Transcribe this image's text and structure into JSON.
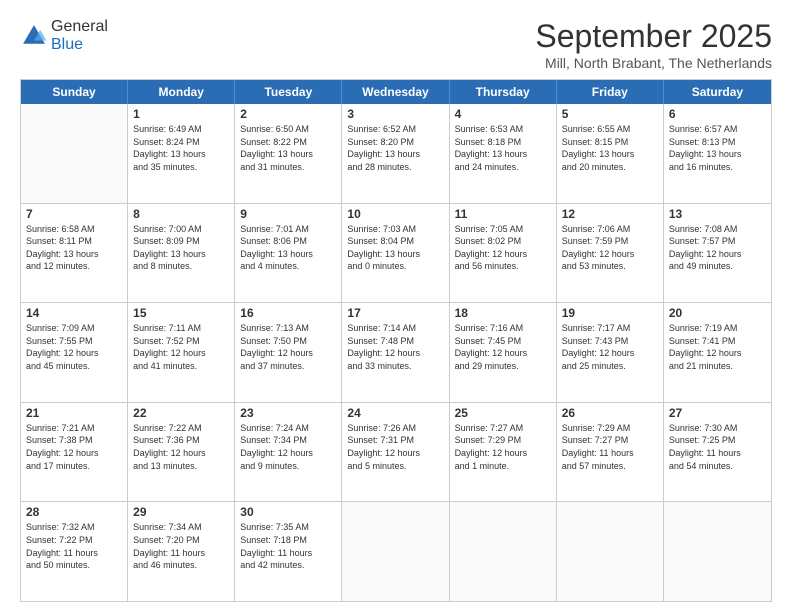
{
  "header": {
    "logo_line1": "General",
    "logo_line2": "Blue",
    "title": "September 2025",
    "subtitle": "Mill, North Brabant, The Netherlands"
  },
  "days_of_week": [
    "Sunday",
    "Monday",
    "Tuesday",
    "Wednesday",
    "Thursday",
    "Friday",
    "Saturday"
  ],
  "weeks": [
    [
      {
        "day": "",
        "empty": true,
        "lines": []
      },
      {
        "day": "1",
        "empty": false,
        "lines": [
          "Sunrise: 6:49 AM",
          "Sunset: 8:24 PM",
          "Daylight: 13 hours",
          "and 35 minutes."
        ]
      },
      {
        "day": "2",
        "empty": false,
        "lines": [
          "Sunrise: 6:50 AM",
          "Sunset: 8:22 PM",
          "Daylight: 13 hours",
          "and 31 minutes."
        ]
      },
      {
        "day": "3",
        "empty": false,
        "lines": [
          "Sunrise: 6:52 AM",
          "Sunset: 8:20 PM",
          "Daylight: 13 hours",
          "and 28 minutes."
        ]
      },
      {
        "day": "4",
        "empty": false,
        "lines": [
          "Sunrise: 6:53 AM",
          "Sunset: 8:18 PM",
          "Daylight: 13 hours",
          "and 24 minutes."
        ]
      },
      {
        "day": "5",
        "empty": false,
        "lines": [
          "Sunrise: 6:55 AM",
          "Sunset: 8:15 PM",
          "Daylight: 13 hours",
          "and 20 minutes."
        ]
      },
      {
        "day": "6",
        "empty": false,
        "lines": [
          "Sunrise: 6:57 AM",
          "Sunset: 8:13 PM",
          "Daylight: 13 hours",
          "and 16 minutes."
        ]
      }
    ],
    [
      {
        "day": "7",
        "empty": false,
        "lines": [
          "Sunrise: 6:58 AM",
          "Sunset: 8:11 PM",
          "Daylight: 13 hours",
          "and 12 minutes."
        ]
      },
      {
        "day": "8",
        "empty": false,
        "lines": [
          "Sunrise: 7:00 AM",
          "Sunset: 8:09 PM",
          "Daylight: 13 hours",
          "and 8 minutes."
        ]
      },
      {
        "day": "9",
        "empty": false,
        "lines": [
          "Sunrise: 7:01 AM",
          "Sunset: 8:06 PM",
          "Daylight: 13 hours",
          "and 4 minutes."
        ]
      },
      {
        "day": "10",
        "empty": false,
        "lines": [
          "Sunrise: 7:03 AM",
          "Sunset: 8:04 PM",
          "Daylight: 13 hours",
          "and 0 minutes."
        ]
      },
      {
        "day": "11",
        "empty": false,
        "lines": [
          "Sunrise: 7:05 AM",
          "Sunset: 8:02 PM",
          "Daylight: 12 hours",
          "and 56 minutes."
        ]
      },
      {
        "day": "12",
        "empty": false,
        "lines": [
          "Sunrise: 7:06 AM",
          "Sunset: 7:59 PM",
          "Daylight: 12 hours",
          "and 53 minutes."
        ]
      },
      {
        "day": "13",
        "empty": false,
        "lines": [
          "Sunrise: 7:08 AM",
          "Sunset: 7:57 PM",
          "Daylight: 12 hours",
          "and 49 minutes."
        ]
      }
    ],
    [
      {
        "day": "14",
        "empty": false,
        "lines": [
          "Sunrise: 7:09 AM",
          "Sunset: 7:55 PM",
          "Daylight: 12 hours",
          "and 45 minutes."
        ]
      },
      {
        "day": "15",
        "empty": false,
        "lines": [
          "Sunrise: 7:11 AM",
          "Sunset: 7:52 PM",
          "Daylight: 12 hours",
          "and 41 minutes."
        ]
      },
      {
        "day": "16",
        "empty": false,
        "lines": [
          "Sunrise: 7:13 AM",
          "Sunset: 7:50 PM",
          "Daylight: 12 hours",
          "and 37 minutes."
        ]
      },
      {
        "day": "17",
        "empty": false,
        "lines": [
          "Sunrise: 7:14 AM",
          "Sunset: 7:48 PM",
          "Daylight: 12 hours",
          "and 33 minutes."
        ]
      },
      {
        "day": "18",
        "empty": false,
        "lines": [
          "Sunrise: 7:16 AM",
          "Sunset: 7:45 PM",
          "Daylight: 12 hours",
          "and 29 minutes."
        ]
      },
      {
        "day": "19",
        "empty": false,
        "lines": [
          "Sunrise: 7:17 AM",
          "Sunset: 7:43 PM",
          "Daylight: 12 hours",
          "and 25 minutes."
        ]
      },
      {
        "day": "20",
        "empty": false,
        "lines": [
          "Sunrise: 7:19 AM",
          "Sunset: 7:41 PM",
          "Daylight: 12 hours",
          "and 21 minutes."
        ]
      }
    ],
    [
      {
        "day": "21",
        "empty": false,
        "lines": [
          "Sunrise: 7:21 AM",
          "Sunset: 7:38 PM",
          "Daylight: 12 hours",
          "and 17 minutes."
        ]
      },
      {
        "day": "22",
        "empty": false,
        "lines": [
          "Sunrise: 7:22 AM",
          "Sunset: 7:36 PM",
          "Daylight: 12 hours",
          "and 13 minutes."
        ]
      },
      {
        "day": "23",
        "empty": false,
        "lines": [
          "Sunrise: 7:24 AM",
          "Sunset: 7:34 PM",
          "Daylight: 12 hours",
          "and 9 minutes."
        ]
      },
      {
        "day": "24",
        "empty": false,
        "lines": [
          "Sunrise: 7:26 AM",
          "Sunset: 7:31 PM",
          "Daylight: 12 hours",
          "and 5 minutes."
        ]
      },
      {
        "day": "25",
        "empty": false,
        "lines": [
          "Sunrise: 7:27 AM",
          "Sunset: 7:29 PM",
          "Daylight: 12 hours",
          "and 1 minute."
        ]
      },
      {
        "day": "26",
        "empty": false,
        "lines": [
          "Sunrise: 7:29 AM",
          "Sunset: 7:27 PM",
          "Daylight: 11 hours",
          "and 57 minutes."
        ]
      },
      {
        "day": "27",
        "empty": false,
        "lines": [
          "Sunrise: 7:30 AM",
          "Sunset: 7:25 PM",
          "Daylight: 11 hours",
          "and 54 minutes."
        ]
      }
    ],
    [
      {
        "day": "28",
        "empty": false,
        "lines": [
          "Sunrise: 7:32 AM",
          "Sunset: 7:22 PM",
          "Daylight: 11 hours",
          "and 50 minutes."
        ]
      },
      {
        "day": "29",
        "empty": false,
        "lines": [
          "Sunrise: 7:34 AM",
          "Sunset: 7:20 PM",
          "Daylight: 11 hours",
          "and 46 minutes."
        ]
      },
      {
        "day": "30",
        "empty": false,
        "lines": [
          "Sunrise: 7:35 AM",
          "Sunset: 7:18 PM",
          "Daylight: 11 hours",
          "and 42 minutes."
        ]
      },
      {
        "day": "",
        "empty": true,
        "lines": []
      },
      {
        "day": "",
        "empty": true,
        "lines": []
      },
      {
        "day": "",
        "empty": true,
        "lines": []
      },
      {
        "day": "",
        "empty": true,
        "lines": []
      }
    ]
  ]
}
